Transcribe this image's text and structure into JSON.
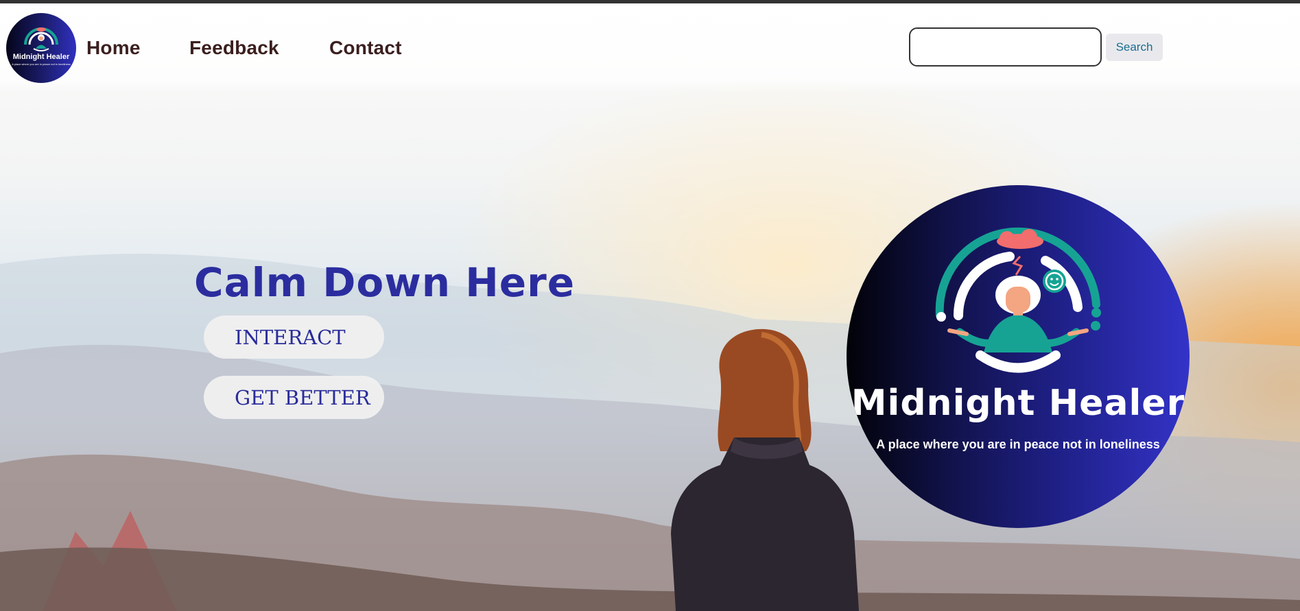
{
  "nav": {
    "logo_brand": "Midnight Healer",
    "logo_tagline": "A place where you are in peace not in loneliness",
    "links": [
      "Home",
      "Feedback",
      "Contact"
    ]
  },
  "search": {
    "value": "",
    "placeholder": "",
    "button_label": "Search"
  },
  "hero": {
    "title": "Calm Down Here",
    "buttons": [
      "INTERACT",
      "GET BETTER"
    ]
  },
  "brand": {
    "name": "Midnight Healer",
    "tagline": "A place where you are in peace not in loneliness"
  },
  "colors": {
    "title": "#2b2d9f",
    "nav_text": "#3b1f1f",
    "logo_teal": "#16a394",
    "logo_cloud": "#f26d6d",
    "search_text": "#1a6e8f"
  }
}
